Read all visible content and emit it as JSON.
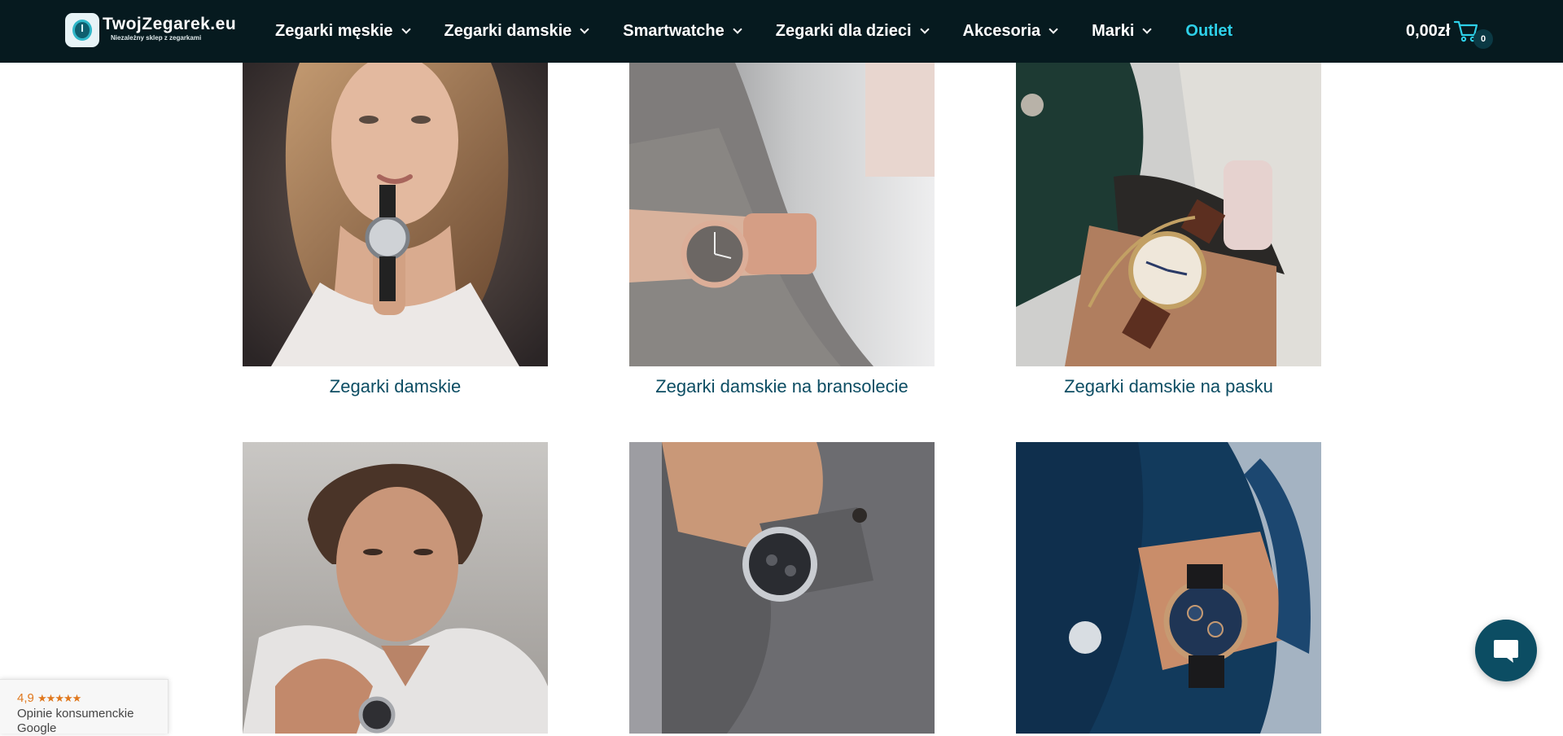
{
  "header": {
    "logo": {
      "name": "TwojZegarek.eu",
      "tagline": "Niezależny sklep z zegarkami"
    },
    "nav": [
      {
        "label": "Zegarki męskie",
        "has_dropdown": true
      },
      {
        "label": "Zegarki damskie",
        "has_dropdown": true
      },
      {
        "label": "Smartwatche",
        "has_dropdown": true
      },
      {
        "label": "Zegarki dla dzieci",
        "has_dropdown": true
      },
      {
        "label": "Akcesoria",
        "has_dropdown": true
      },
      {
        "label": "Marki",
        "has_dropdown": true
      },
      {
        "label": "Outlet",
        "has_dropdown": false
      }
    ],
    "cart": {
      "total": "0,00zł",
      "count": "0",
      "icon": "shopping-cart-icon"
    }
  },
  "categories": [
    {
      "label": "Zegarki damskie",
      "image": "woman-portrait-holding-watch"
    },
    {
      "label": "Zegarki damskie na bransolecie",
      "image": "wrist-rose-gold-bracelet-watch"
    },
    {
      "label": "Zegarki damskie na pasku",
      "image": "wrist-leather-strap-watch"
    },
    {
      "label": "",
      "image": "man-portrait-white-shirt"
    },
    {
      "label": "",
      "image": "wrist-silver-chronograph-grey-jacket"
    },
    {
      "label": "",
      "image": "wrist-blue-dial-watch-navy-jacket"
    }
  ],
  "reviews_widget": {
    "rating": "4,9",
    "stars": "★★★★★",
    "label_line1": "Opinie konsumenckie",
    "label_line2": "Google"
  },
  "chat": {
    "icon": "chat-bubble-icon"
  },
  "colors": {
    "header_bg": "#061a1f",
    "accent": "#2ed0e8",
    "link": "#0c4d63",
    "rating": "#e0781e"
  }
}
